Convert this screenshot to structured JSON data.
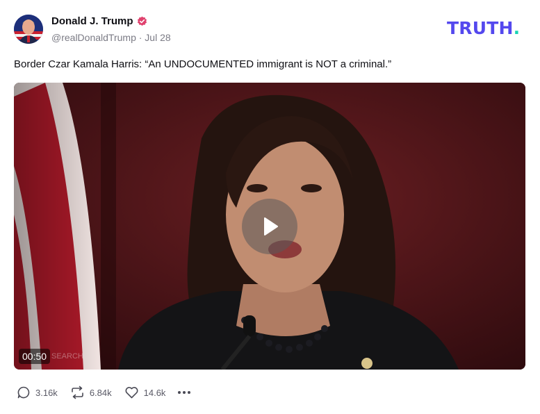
{
  "author": {
    "name": "Donald J. Trump",
    "handle": "@realDonaldTrump",
    "date": "Jul 28",
    "meta": "@realDonaldTrump · Jul 28",
    "verified": true
  },
  "brand": {
    "logo_text": "TRUTH",
    "logo_dot": ".",
    "color": "#5448ee",
    "dot_color": "#17d4b3"
  },
  "post": {
    "text": "Border Czar Kamala Harris: “An UNDOCUMENTED immigrant is NOT a criminal.”"
  },
  "video": {
    "duration": "00:50",
    "play_icon": "play-icon"
  },
  "actions": {
    "replies": "3.16k",
    "retruths": "6.84k",
    "likes": "14.6k",
    "reply_icon": "comment-icon",
    "retruth_icon": "repost-icon",
    "like_icon": "heart-icon",
    "more_icon": "more-icon"
  }
}
